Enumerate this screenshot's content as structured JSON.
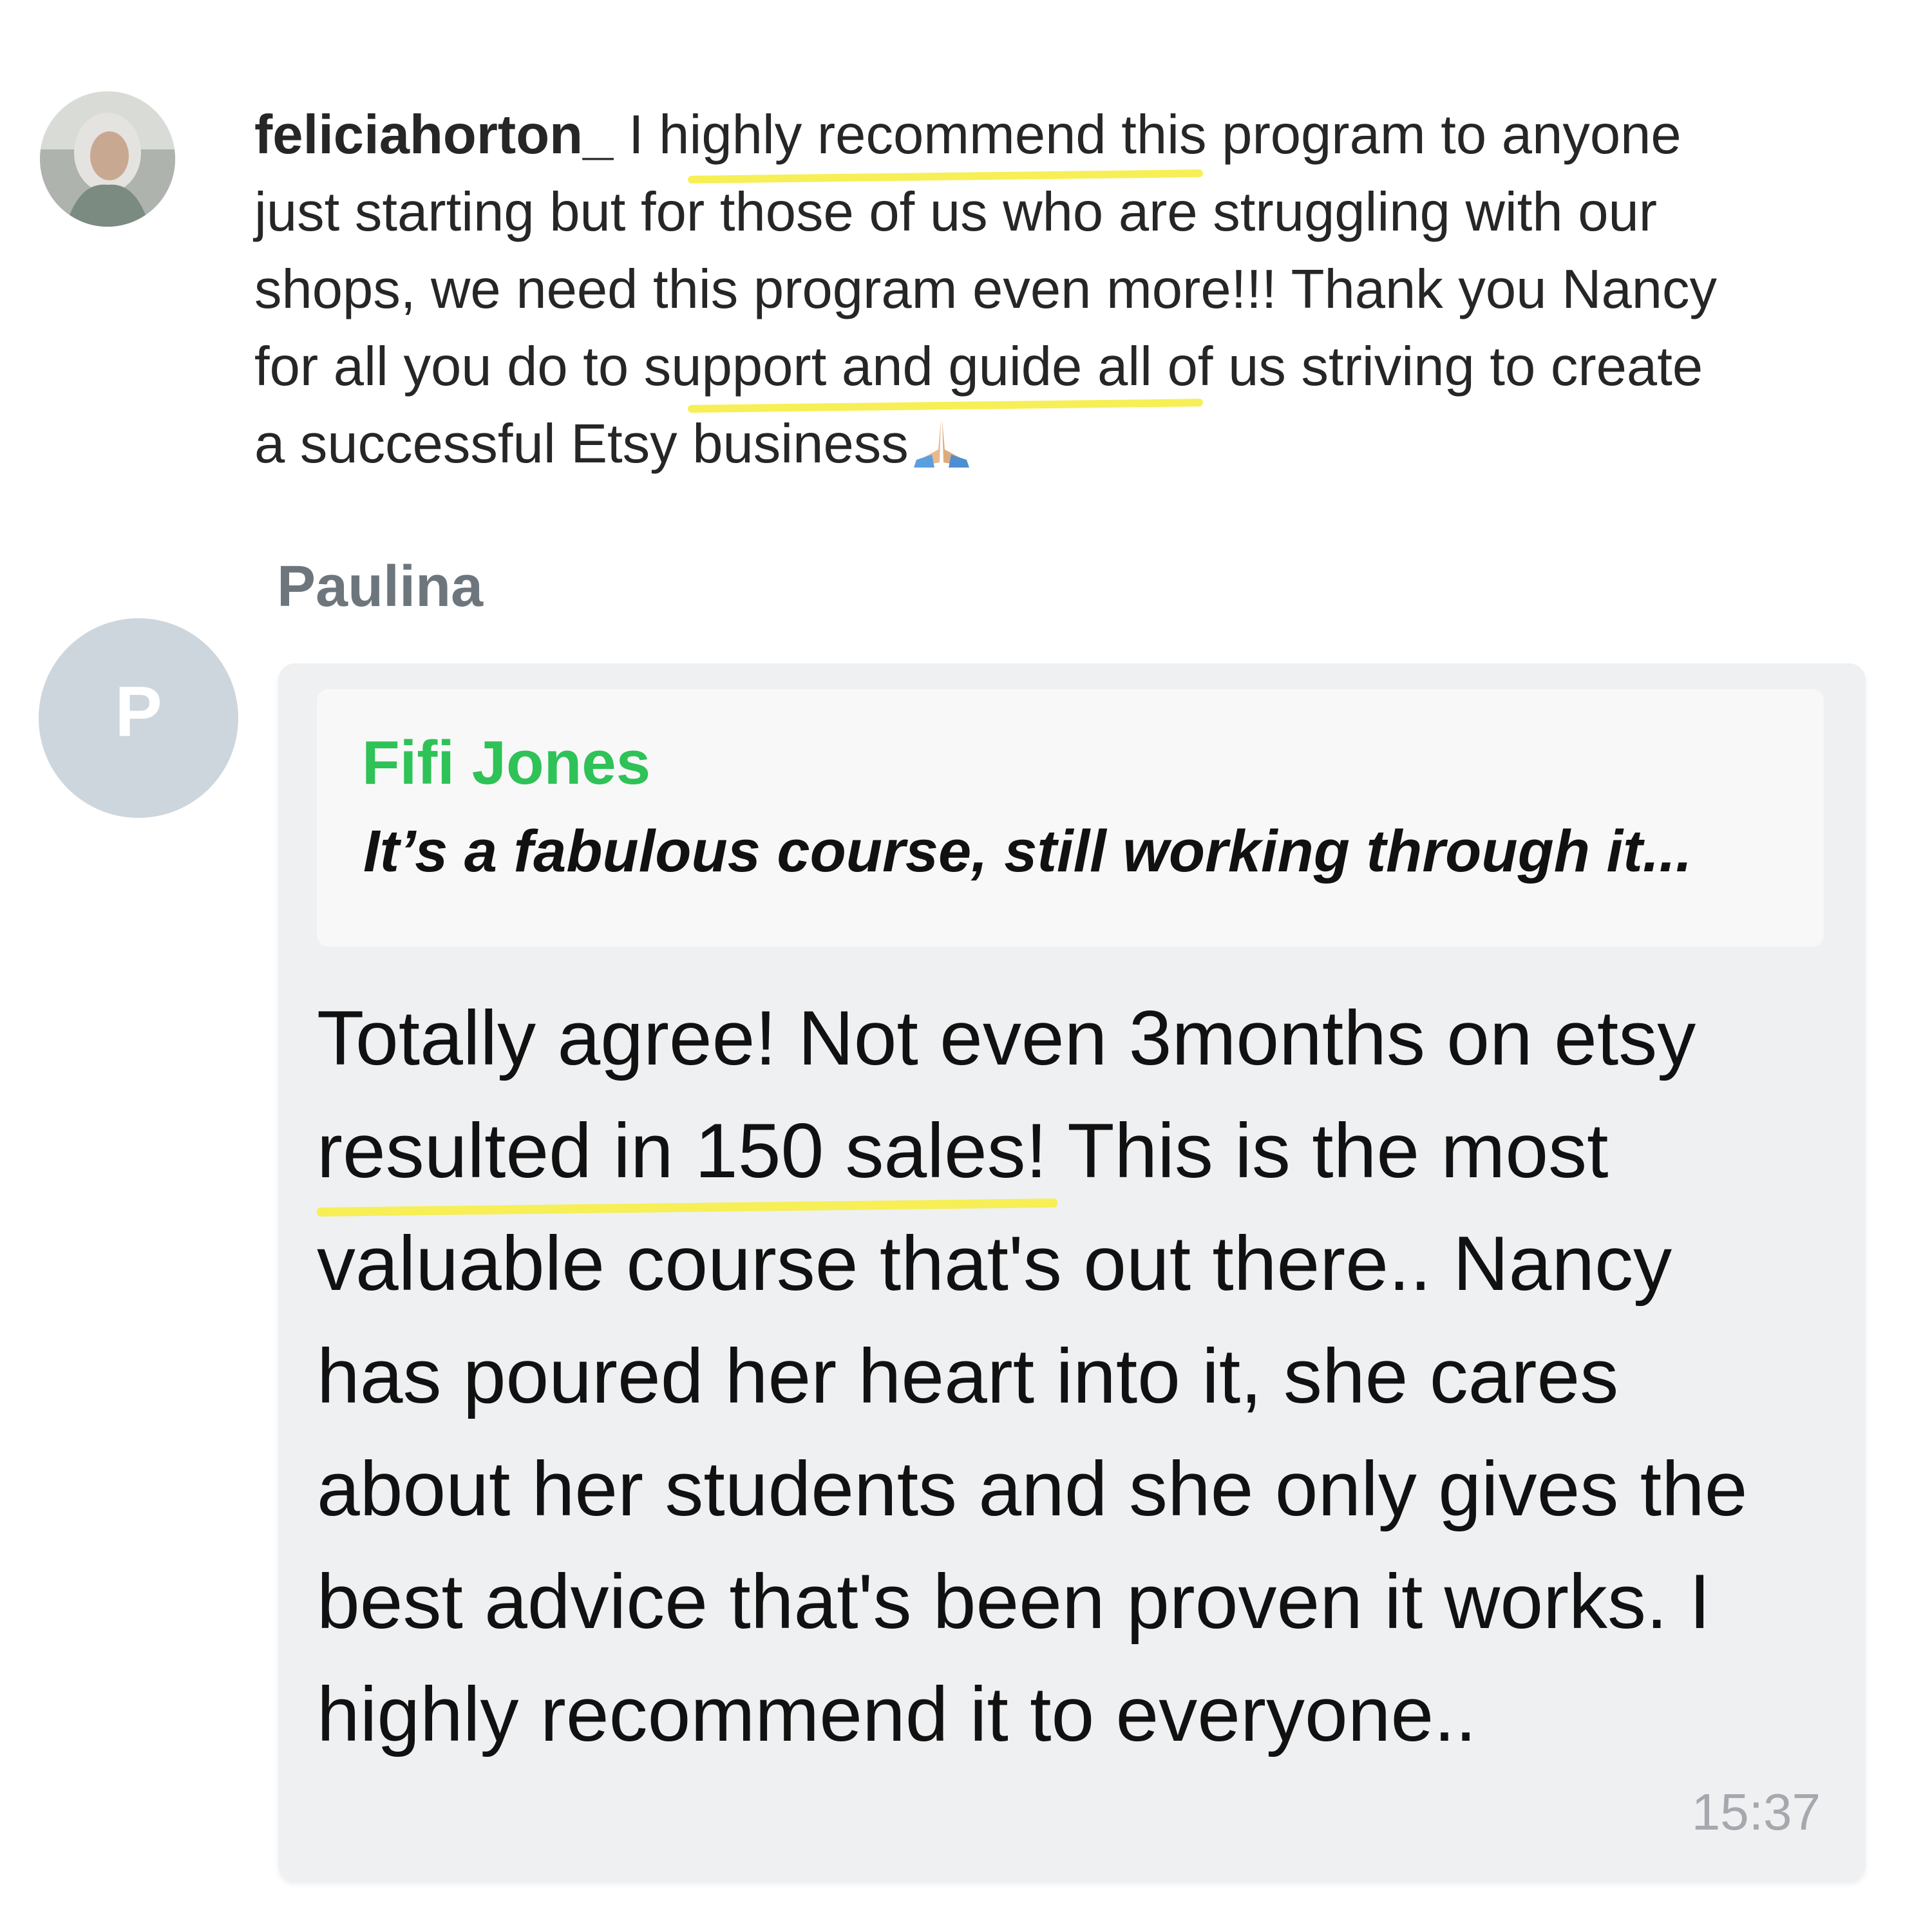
{
  "instagram_comment": {
    "username": "feliciahorton_",
    "lines": [
      " I highly recommend this program to anyone",
      "just starting but for those of us who are struggling with our",
      "shops, we need this program even more!!! Thank you Nancy",
      "for all you do to support and guide all of us striving to create",
      "a successful Etsy business"
    ],
    "emoji": "folded-hands-emoji",
    "highlight_color": "#f7ef56"
  },
  "telegram_message": {
    "sender": "Paulina",
    "avatar_initial": "P",
    "avatar_color": "#cdd6dc",
    "reply_quote": {
      "author": "Fifi Jones",
      "text": "It’s a fabulous course, still working through it..."
    },
    "body_lines": [
      "Totally agree! Not even 3months on etsy",
      "resulted in 150 sales! This is the most",
      "valuable course that's out there.. Nancy",
      "has poured her heart into it, she cares",
      "about her students and she only gives the",
      "best advice that's been proven it works. I",
      "highly recommend it to everyone.."
    ],
    "time": "15:37",
    "quote_author_color": "#2ec257",
    "bubble_color": "#eff0f2"
  }
}
